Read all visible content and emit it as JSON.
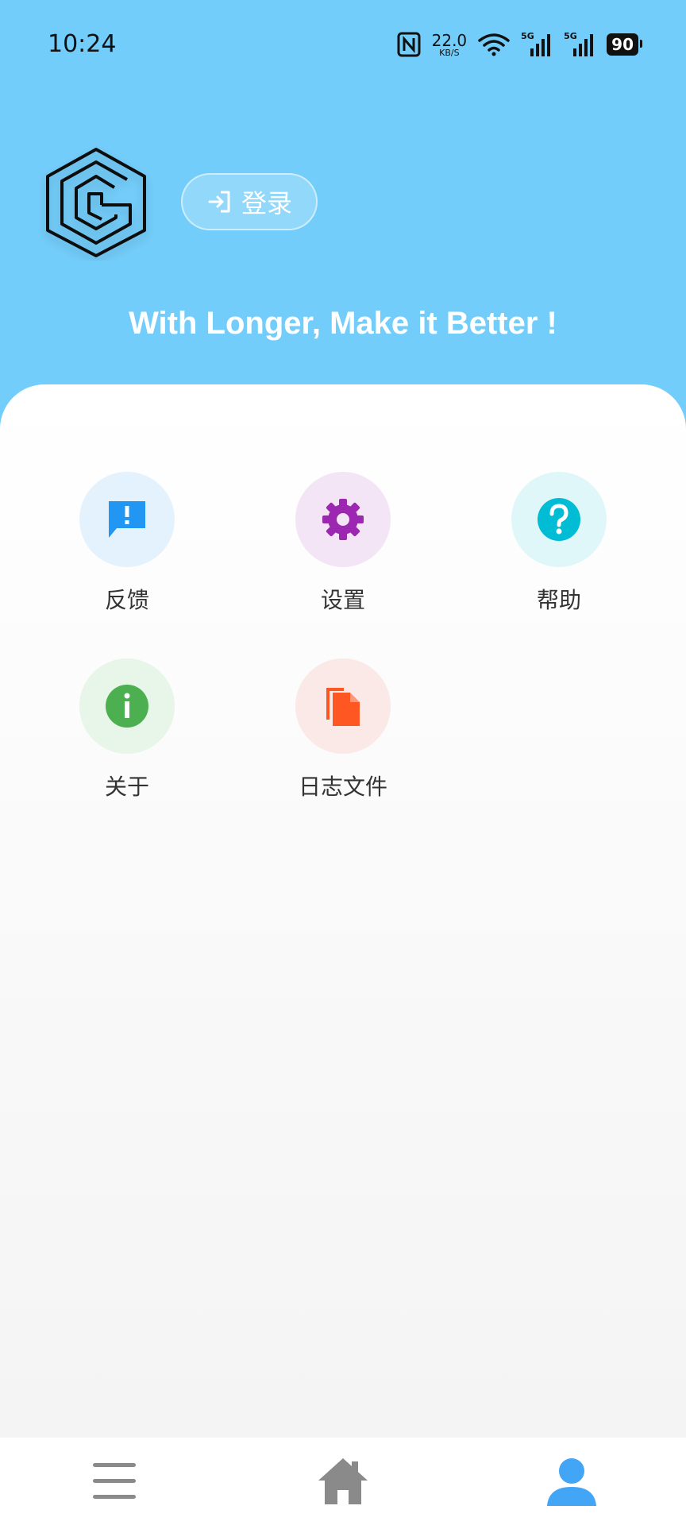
{
  "status_bar": {
    "time": "10:24",
    "net_speed_value": "22.0",
    "net_speed_unit": "KB/S",
    "sim1_tag": "5G",
    "sim2_tag": "5G",
    "battery": "90"
  },
  "header": {
    "login_label": "登录",
    "slogan": "With Longer, Make it Better !"
  },
  "menu": {
    "items": [
      {
        "label": "反馈",
        "icon": "feedback-icon",
        "color": "#2196F3",
        "bg": "#E3F2FD"
      },
      {
        "label": "设置",
        "icon": "gear-icon",
        "color": "#9C27B0",
        "bg": "#F3E5F5"
      },
      {
        "label": "帮助",
        "icon": "help-icon",
        "color": "#00BCD4",
        "bg": "#E0F7FA"
      },
      {
        "label": "关于",
        "icon": "info-icon",
        "color": "#4CAF50",
        "bg": "#E8F5E9"
      },
      {
        "label": "日志文件",
        "icon": "file-copy-icon",
        "color": "#FF5722",
        "bg": "#FBE9E7"
      }
    ]
  },
  "bottom_nav": {
    "items": [
      {
        "icon": "menu-icon",
        "active": false
      },
      {
        "icon": "home-icon",
        "active": false
      },
      {
        "icon": "person-icon",
        "active": true
      }
    ]
  },
  "colors": {
    "header_bg": "#73cdfa",
    "nav_inactive": "#8a8a8a",
    "nav_active": "#42a5f5"
  }
}
